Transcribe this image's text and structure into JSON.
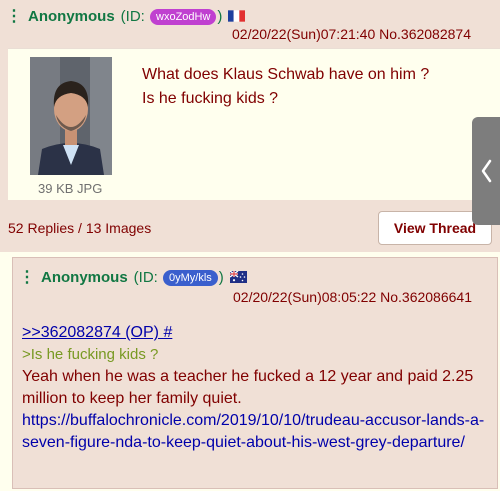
{
  "op": {
    "name": "Anonymous",
    "id_prefix": "(ID:",
    "id": "wxoZodHw",
    "id_suffix": ")",
    "id_color": "#c040d0",
    "date": "02/20/22(Sun)07:21:40",
    "post_no": "No.362082874",
    "file_info": "39 KB JPG",
    "text_lines": [
      "What does Klaus Schwab have on him ?",
      "Is he fucking kids ?"
    ],
    "stats": "52 Replies / 13 Images",
    "view_thread_label": "View Thread",
    "menu_icon": "vertical-dots-icon",
    "flag_icon": "france-flag-icon"
  },
  "side_tab": {
    "icon": "chevron-left-icon",
    "glyph": "‹"
  },
  "reply": {
    "name": "Anonymous",
    "id_prefix": "(ID:",
    "id": "0yMy/kls",
    "id_suffix": ")",
    "id_color": "#3a5fcd",
    "date": "02/20/22(Sun)08:05:22",
    "post_no": "No.362086641",
    "quote_link": ">>362082874 (OP) #",
    "greentext": ">Is he fucking kids ?",
    "text": "Yeah when he was a teacher he fucked a 12 year and paid 2.25 million to keep her family quiet.",
    "url": "https://buffalochronicle.com/2019/10/10/trudeau-accusor-lands-a-seven-figure-nda-to-keep-quiet-about-his-west-grey-departure/",
    "flag_icon": "australia-flag-icon"
  }
}
